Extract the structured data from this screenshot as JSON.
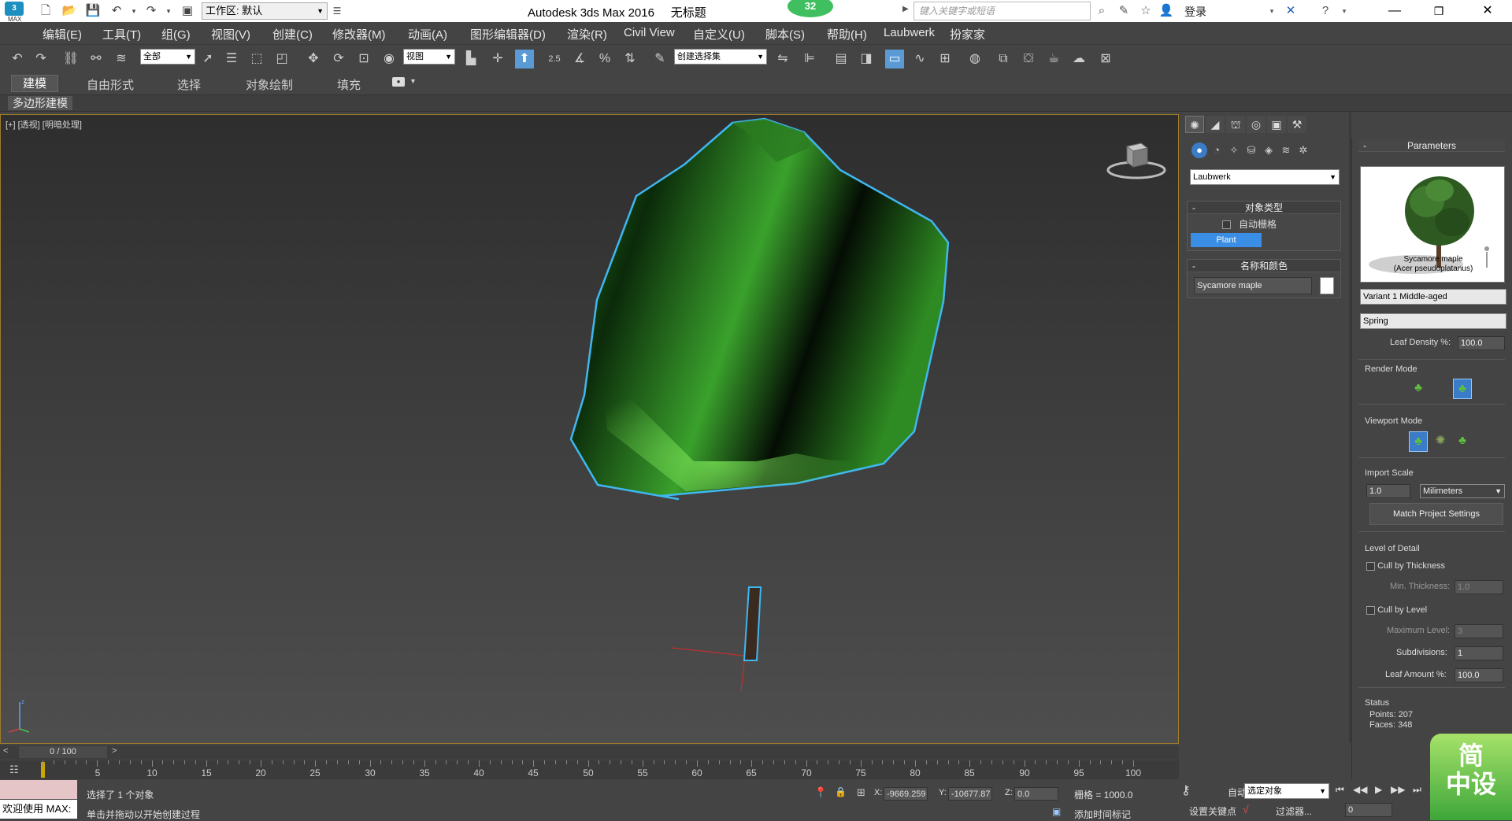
{
  "window": {
    "title": "Autodesk 3ds Max 2016",
    "doc_title": "无标题",
    "badge": "32",
    "app_abbr": "3",
    "app_label": "MAX",
    "workspace": "工作区: 默认",
    "search_placeholder": "键入关键字或短语",
    "login": "登录"
  },
  "menu": {
    "items": [
      "编辑(E)",
      "工具(T)",
      "组(G)",
      "视图(V)",
      "创建(C)",
      "修改器(M)",
      "动画(A)",
      "图形编辑器(D)",
      "渲染(R)",
      "Civil View",
      "自定义(U)",
      "脚本(S)",
      "帮助(H)",
      "Laubwerk",
      "扮家家"
    ]
  },
  "toolbar": {
    "selection_filter": "全部",
    "ref_coord": "视图",
    "snap_angle": "2.5",
    "named_selection": "创建选择集"
  },
  "ribbon": {
    "tabs": [
      "建模",
      "自由形式",
      "选择",
      "对象绘制",
      "填充"
    ],
    "active_tab": "建模",
    "panel_label": "多边形建模"
  },
  "viewport": {
    "label": "[+] [透视] [明暗处理]",
    "tree_color_light": "#6fd44f",
    "tree_color_dark": "#0f2a0d",
    "selection_color": "#3fb7f0"
  },
  "timeline": {
    "frame_indicator": "0 / 100",
    "ticks": [
      "5",
      "10",
      "15",
      "20",
      "25",
      "30",
      "35",
      "40",
      "45",
      "50",
      "55",
      "60",
      "65",
      "70",
      "75",
      "80",
      "85",
      "90",
      "95",
      "100"
    ]
  },
  "status": {
    "selection_msg": "选择了 1 个对象",
    "prompt_msg": "单击并拖动以开始创建过程",
    "maxscript_label": "欢迎使用 MAX:",
    "x_label": "X:",
    "x_value": "-9669.259",
    "y_label": "Y:",
    "y_value": "-10677.87",
    "z_label": "Z:",
    "z_value": "0.0",
    "grid": "栅格 = 1000.0",
    "add_time_tag": "添加时间标记"
  },
  "anim": {
    "auto": "自动",
    "set_key": "设置关键点",
    "selected_object": "选定对象",
    "filters": "过滤器...",
    "frame": "0"
  },
  "command_panel": {
    "category": "Laubwerk",
    "object_type_title": "对象类型",
    "auto_grid": "自动栅格",
    "plant_button": "Plant",
    "name_color_title": "名称和颜色",
    "object_name": "Sycamore maple"
  },
  "parameters": {
    "title": "Parameters",
    "preview_caption_1": "Sycamore maple",
    "preview_caption_2": "(Acer pseudoplatanus)",
    "variant": "Variant 1 Middle-aged",
    "season": "Spring",
    "leaf_density_label": "Leaf Density %:",
    "leaf_density": "100.0",
    "render_mode_label": "Render Mode",
    "viewport_mode_label": "Viewport Mode",
    "import_scale_label": "Import Scale",
    "import_scale": "1.0",
    "units": "Milimeters",
    "match_project": "Match Project Settings",
    "lod_label": "Level of Detail",
    "cull_thickness": "Cull by Thickness",
    "min_thickness_label": "Min. Thickness:",
    "min_thickness": "1.0",
    "cull_level": "Cull by Level",
    "max_level_label": "Maximum Level:",
    "max_level": "3",
    "subdivisions_label": "Subdivisions:",
    "subdivisions": "1",
    "leaf_amount_label": "Leaf Amount %:",
    "leaf_amount": "100.0",
    "status_label": "Status",
    "points": "Points: 207",
    "faces": "Faces: 348"
  },
  "watermark": {
    "line1": "简",
    "line2": "中设"
  }
}
